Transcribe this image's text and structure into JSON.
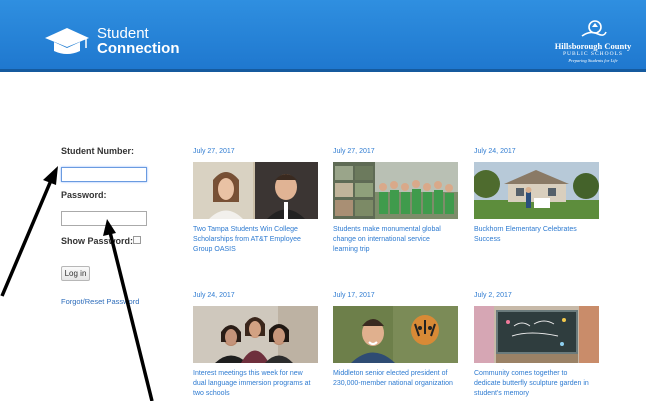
{
  "header": {
    "app_title_line1": "Student",
    "app_title_line2": "Connection",
    "district_name": "Hillsborough County",
    "district_subtitle": "PUBLIC SCHOOLS",
    "district_tagline": "Preparing Students for Life",
    "background_color": "#1f78cf",
    "icons": [
      "graduation-cap-icon",
      "district-emblem-icon"
    ]
  },
  "login": {
    "student_number_label": "Student Number:",
    "student_number_value": "",
    "password_label": "Password:",
    "password_value": "",
    "show_password_label": "Show Password:",
    "login_button": "Log in",
    "forgot_link": "Forgot/Reset Password"
  },
  "news": [
    {
      "date": "July 27, 2017",
      "title": "Two Tampa Students Win College Scholarships from AT&T Employee Group OASIS"
    },
    {
      "date": "July 27, 2017",
      "title": "Students make monumental global change on international service learning trip"
    },
    {
      "date": "July 24, 2017",
      "title": "Buckhorn Elementary Celebrates Success"
    },
    {
      "date": "July 24, 2017",
      "title": "Interest meetings this week for new dual language immersion programs at two schools"
    },
    {
      "date": "July 17, 2017",
      "title": "Middleton senior elected president of 230,000-member national organization"
    },
    {
      "date": "July 2, 2017",
      "title": "Community comes together to dedicate butterfly sculpture garden in student's memory"
    }
  ],
  "colors": {
    "link": "#2e7bd1",
    "header": "#1f78cf"
  }
}
